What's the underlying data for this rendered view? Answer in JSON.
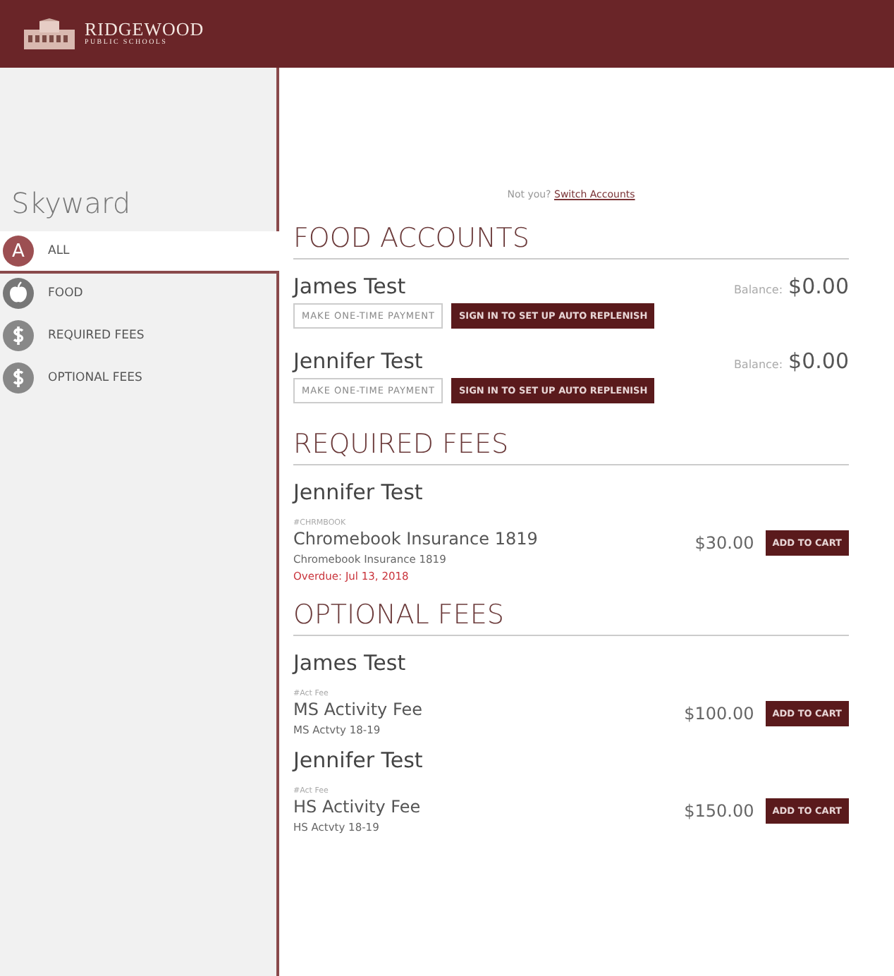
{
  "header": {
    "logo_name": "RIDGEWOOD",
    "logo_sub": "PUBLIC SCHOOLS"
  },
  "sidebar": {
    "title": "Skyward",
    "items": [
      {
        "label": "ALL",
        "kind": "letter",
        "badge": "A",
        "selected": true
      },
      {
        "label": "FOOD",
        "kind": "apple",
        "selected": false
      },
      {
        "label": "REQUIRED FEES",
        "kind": "dollar",
        "selected": false
      },
      {
        "label": "OPTIONAL FEES",
        "kind": "dollar",
        "selected": false
      }
    ]
  },
  "account_notice": {
    "text": "Not you?",
    "link": "Switch Accounts"
  },
  "food_accounts": {
    "title": "FOOD ACCOUNTS",
    "accounts": [
      {
        "name": "James Test",
        "payment_button": "MAKE ONE-TIME PAYMENT",
        "replenish_button": "SIGN IN TO SET UP AUTO REPLENISH",
        "balance_label": "Balance:",
        "balance": "$0.00"
      },
      {
        "name": "Jennifer Test",
        "payment_button": "MAKE ONE-TIME PAYMENT",
        "replenish_button": "SIGN IN TO SET UP AUTO REPLENISH",
        "balance_label": "Balance:",
        "balance": "$0.00"
      }
    ]
  },
  "fee_sections": [
    {
      "title": "REQUIRED FEES",
      "students": [
        {
          "name": "Jennifer Test",
          "fees": [
            {
              "code": "#CHRMBOOK",
              "title": "Chromebook Insurance 1819",
              "description": "Chromebook Insurance 1819",
              "overdue": "Overdue: Jul 13, 2018",
              "price": "$30.00",
              "button": "ADD TO CART"
            }
          ]
        }
      ]
    },
    {
      "title": "OPTIONAL FEES",
      "students": [
        {
          "name": "James Test",
          "fees": [
            {
              "code": "#Act Fee",
              "title": "MS Activity Fee",
              "description": "MS Actvty 18-19",
              "price": "$100.00",
              "button": "ADD TO CART"
            }
          ]
        },
        {
          "name": "Jennifer Test",
          "fees": [
            {
              "code": "#Act Fee",
              "title": "HS Activity Fee",
              "description": "HS Actvty 18-19",
              "price": "$150.00",
              "button": "ADD TO CART"
            }
          ]
        }
      ]
    }
  ]
}
